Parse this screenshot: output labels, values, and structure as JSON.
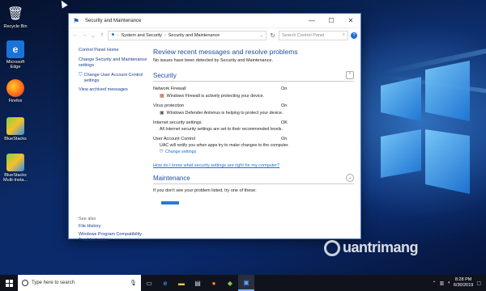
{
  "desktop": {
    "icons": [
      {
        "label": "Recycle Bin",
        "icon": "recycle-bin-icon"
      },
      {
        "label": "Microsoft Edge",
        "icon": "edge-icon"
      },
      {
        "label": "Firefox",
        "icon": "firefox-icon"
      },
      {
        "label": "BlueStacks",
        "icon": "bluestacks-icon"
      },
      {
        "label": "BlueStacks Multi-Insta...",
        "icon": "bluestacks-multi-icon"
      }
    ]
  },
  "window": {
    "title": "Security and Maintenance",
    "controls": {
      "minimize": "—",
      "maximize": "☐",
      "close": "✕"
    },
    "address": {
      "crumbs": [
        "System and Security",
        "Security and Maintenance"
      ],
      "search_placeholder": "Search Control Panel"
    },
    "left_nav": {
      "items": [
        "Control Panel Home",
        "Change Security and Maintenance settings",
        "Change User Account Control settings",
        "View archived messages"
      ],
      "see_also_label": "See also",
      "see_also": [
        "File History",
        "Windows Program Compatibility Troubleshooter"
      ]
    },
    "main": {
      "heading": "Review recent messages and resolve problems",
      "subtext": "No issues have been detected by Security and Maintenance.",
      "security_title": "Security",
      "items": [
        {
          "name": "Network Firewall",
          "status": "On",
          "detail": "Windows Firewall is actively protecting your device."
        },
        {
          "name": "Virus protection",
          "status": "On",
          "detail": "Windows Defender Antivirus is helping to protect your device."
        },
        {
          "name": "Internet security settings",
          "status": "OK",
          "detail": "All Internet security settings are set to their recommended levels."
        },
        {
          "name": "User Account Control",
          "status": "On",
          "detail": "UAC will notify you when apps try to make changes to the computer."
        }
      ],
      "change_settings": "Change settings",
      "how_link": "How do I know what security settings are right for my computer?",
      "maintenance_title": "Maintenance",
      "if_not": "If you don't see your problem listed, try one of these:"
    }
  },
  "watermark": "uantrimang",
  "taskbar": {
    "search_placeholder": "Type here to search",
    "time": "8:28 PM",
    "date": "6/30/2019"
  }
}
